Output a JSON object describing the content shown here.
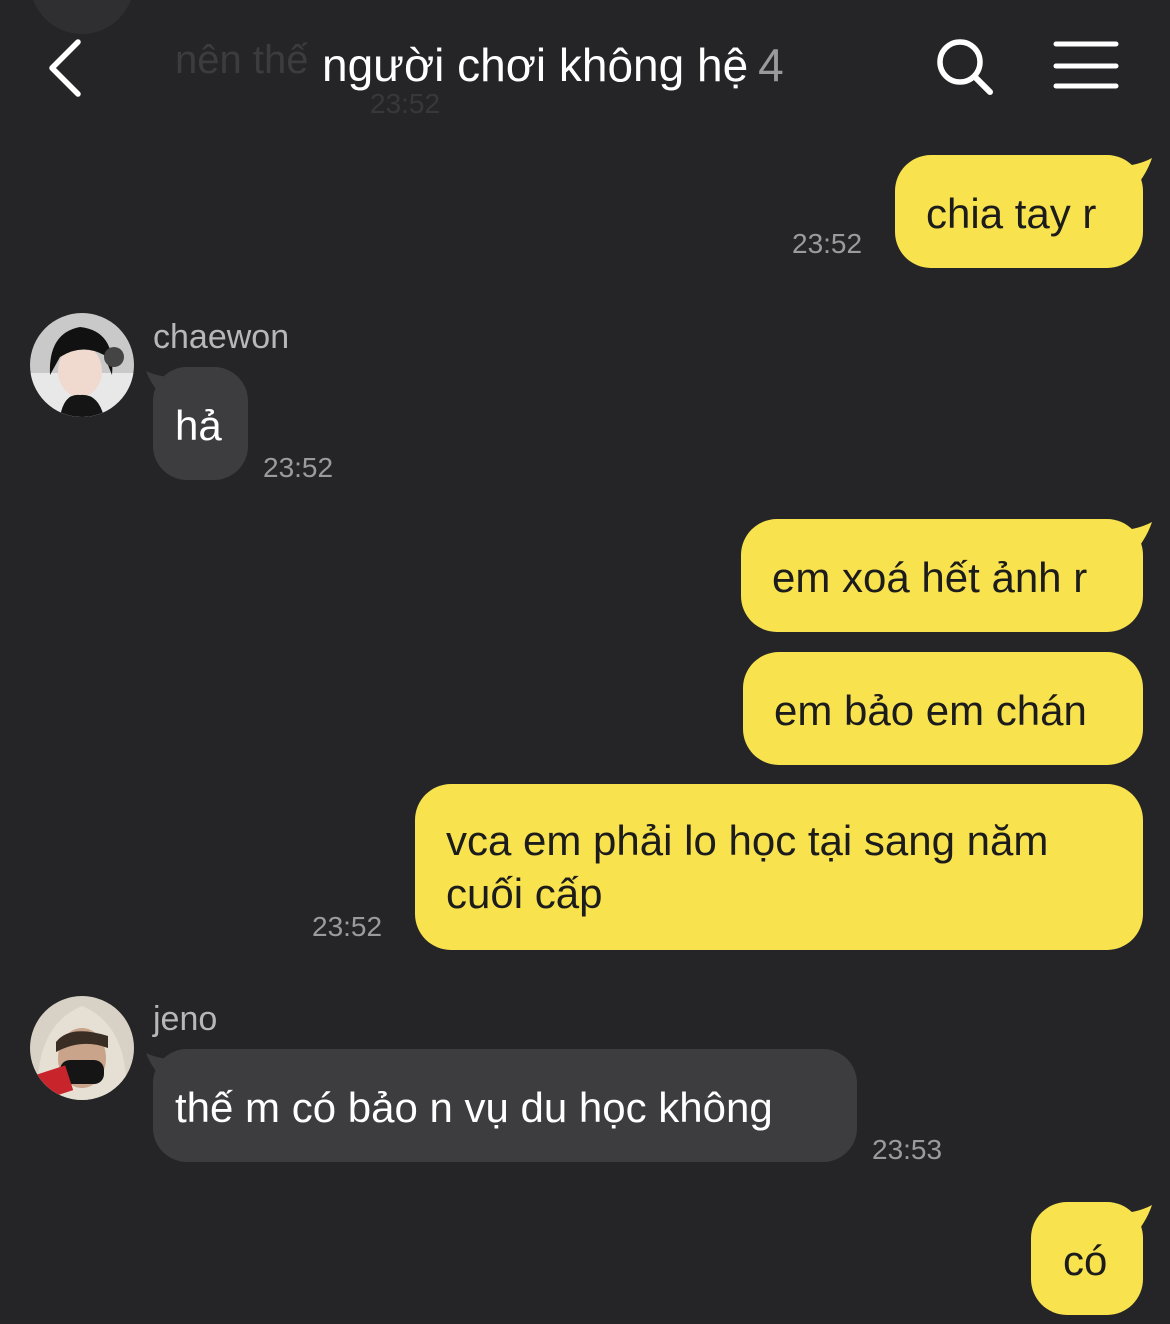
{
  "header": {
    "title": "người chơi không hệ",
    "member_count": "4",
    "ghost_preview_text": "nên thế",
    "ghost_preview_time": "23:52"
  },
  "messages": [
    {
      "id": "m1",
      "direction": "outgoing",
      "text": "chia tay r",
      "time": "23:52"
    },
    {
      "id": "m2",
      "direction": "incoming",
      "sender": "chaewon",
      "text": "hả",
      "time": "23:52"
    },
    {
      "id": "m3",
      "direction": "outgoing",
      "text": "em xoá hết ảnh r"
    },
    {
      "id": "m4",
      "direction": "outgoing",
      "text": "em bảo em chán"
    },
    {
      "id": "m5",
      "direction": "outgoing",
      "lines": [
        "vca em phải lo học tại sang năm",
        "cuối cấp"
      ],
      "time": "23:52"
    },
    {
      "id": "m6",
      "direction": "incoming",
      "sender": "jeno",
      "text": "thế m có bảo n vụ du học không",
      "time": "23:53"
    },
    {
      "id": "m7",
      "direction": "outgoing",
      "text": "có"
    }
  ],
  "colors": {
    "background": "#252527",
    "outgoing_bubble": "#f8e24d",
    "incoming_bubble": "#3d3d40",
    "timestamp": "#9b9b9f"
  },
  "icons": [
    "back-arrow-icon",
    "search-icon",
    "hamburger-menu-icon"
  ]
}
